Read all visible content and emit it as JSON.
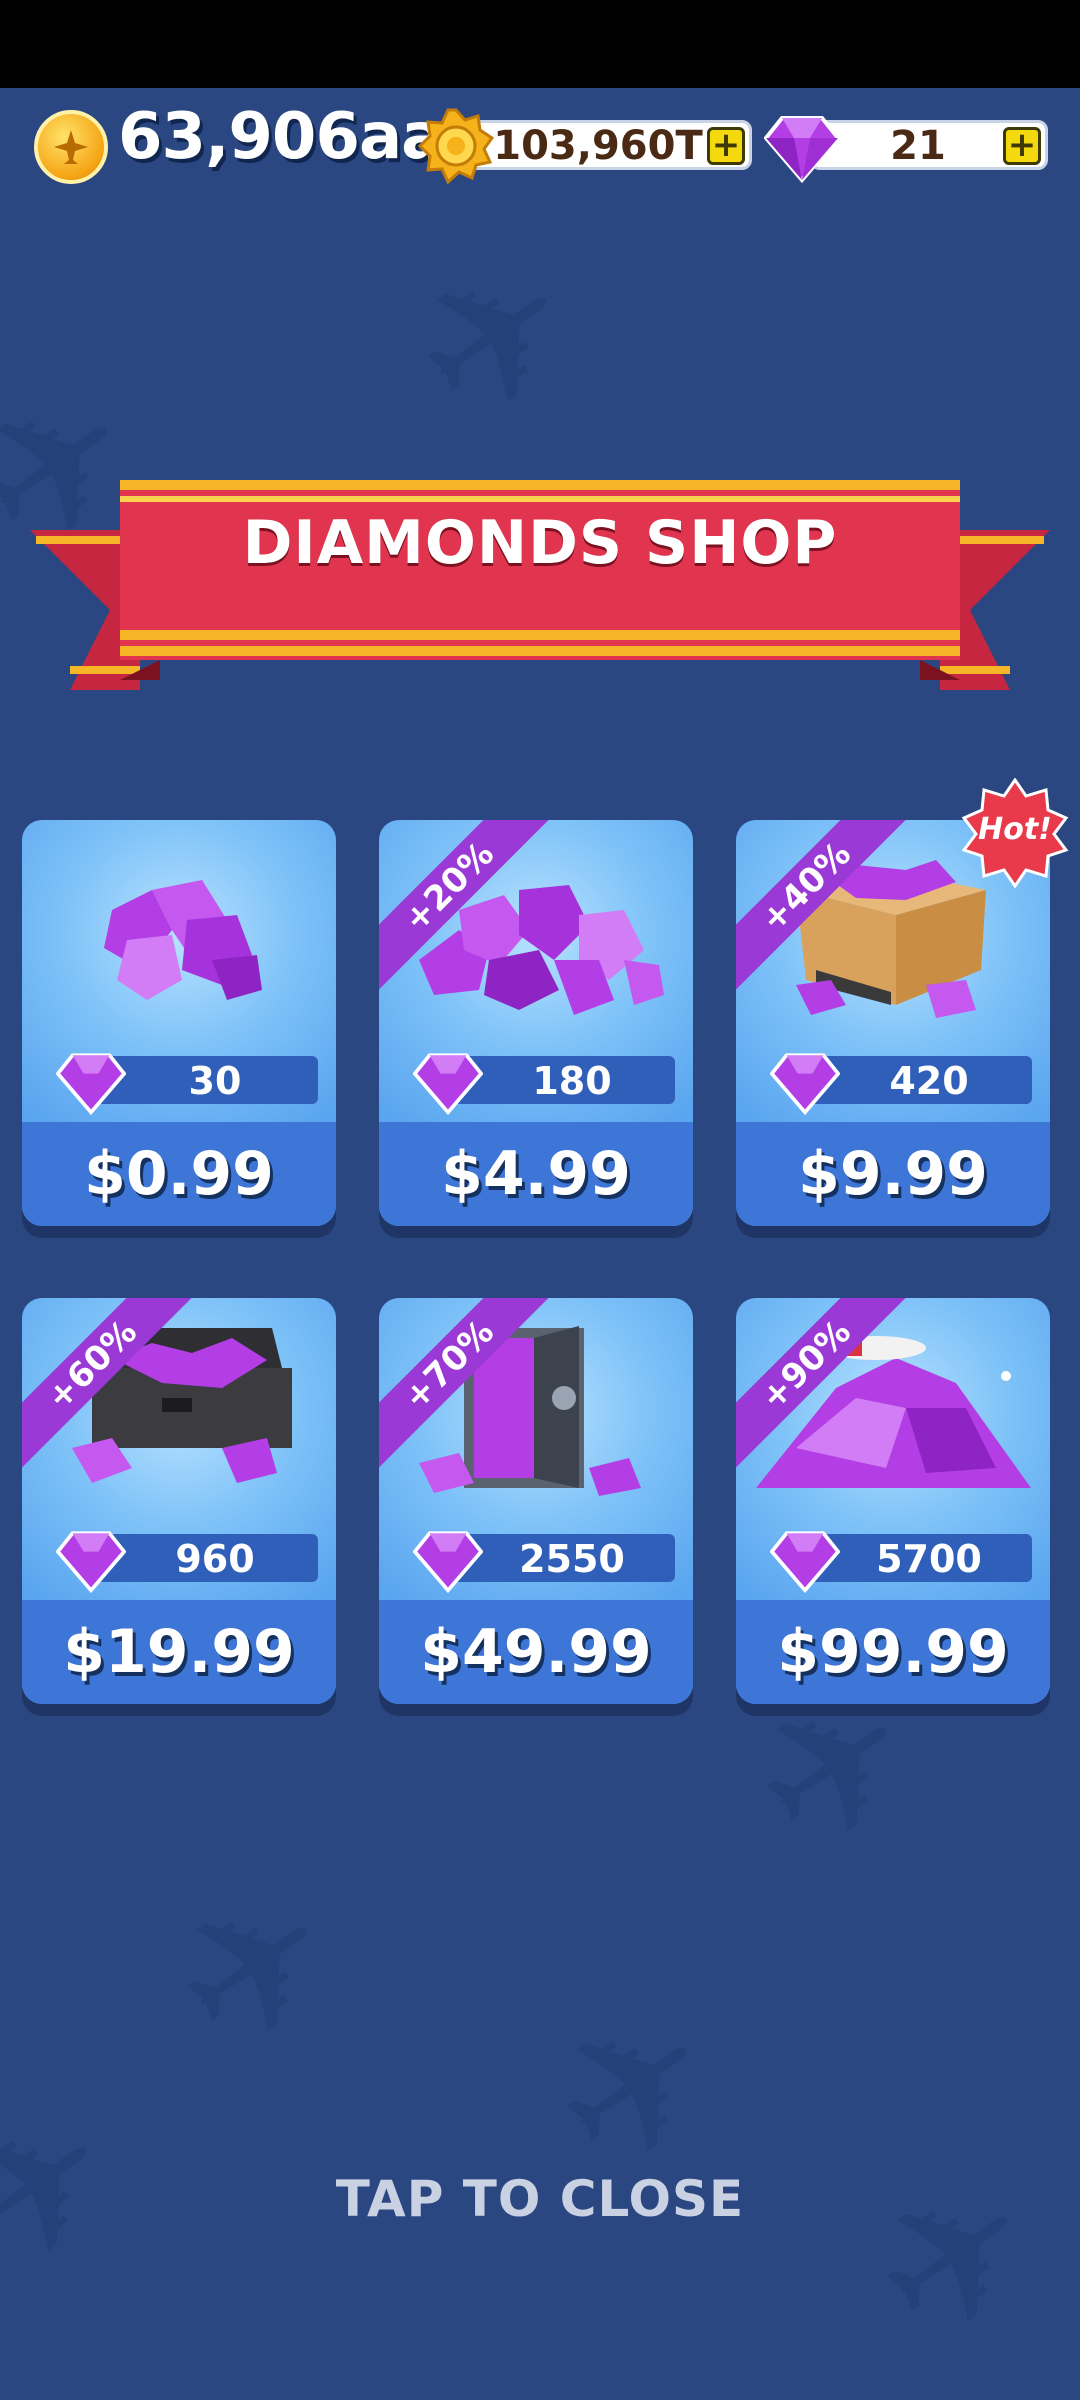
{
  "header": {
    "coins": "63,906aa",
    "medals": "103,960T",
    "gems": "21",
    "plus_symbol": "+"
  },
  "shop": {
    "title": "DIAMONDS SHOP",
    "hot_label": "Hot!",
    "items": [
      {
        "amount": "30",
        "price": "$0.99",
        "bonus": ""
      },
      {
        "amount": "180",
        "price": "$4.99",
        "bonus": "+20%"
      },
      {
        "amount": "420",
        "price": "$9.99",
        "bonus": "+40%"
      },
      {
        "amount": "960",
        "price": "$19.99",
        "bonus": "+60%"
      },
      {
        "amount": "2550",
        "price": "$49.99",
        "bonus": "+70%"
      },
      {
        "amount": "5700",
        "price": "$99.99",
        "bonus": "+90%"
      }
    ]
  },
  "footer": {
    "close_label": "TAP TO CLOSE"
  },
  "colors": {
    "background": "#2a4782",
    "ribbon": "#e0344f",
    "gem": "#b43ee6",
    "bonus_band": "#9a39d6"
  },
  "icons": [
    "coin-plane-icon",
    "medal-icon",
    "gem-icon",
    "plus-icon",
    "hot-badge-icon"
  ]
}
